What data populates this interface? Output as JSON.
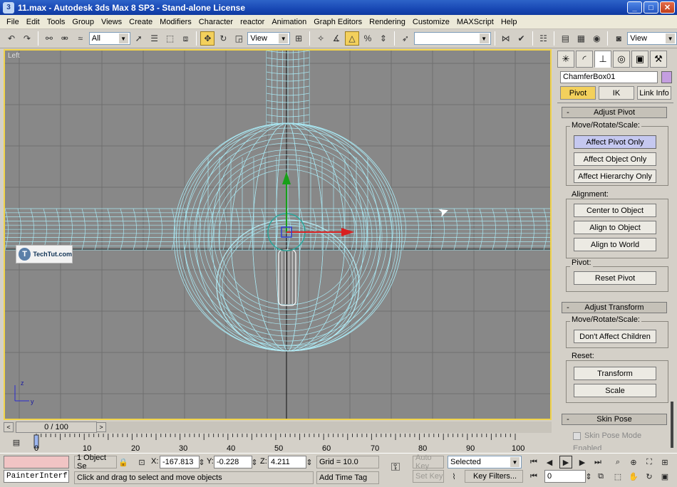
{
  "window": {
    "title": "11.max - Autodesk 3ds Max 8 SP3  - Stand-alone License",
    "app_icon": "3",
    "buttons": [
      "_",
      "□",
      "✕"
    ]
  },
  "menu": [
    "File",
    "Edit",
    "Tools",
    "Group",
    "Views",
    "Create",
    "Modifiers",
    "Character",
    "reactor",
    "Animation",
    "Graph Editors",
    "Rendering",
    "Customize",
    "MAXScript",
    "Help"
  ],
  "toolbar": {
    "selection_filter": "All",
    "ref_coord": "View",
    "named_selection": "",
    "right_view": "View"
  },
  "viewport": {
    "label": "Left",
    "watermark": "TechTut.com",
    "watermark_logo": "T",
    "axis_z": "z",
    "axis_y": "y"
  },
  "command_panel": {
    "object_name": "ChamferBox01",
    "object_color": "#c49ee0",
    "tabs": [
      "Pivot",
      "IK",
      "Link Info"
    ],
    "adjust_pivot": {
      "title": "Adjust Pivot",
      "minus": "-",
      "move_group": "Move/Rotate/Scale:",
      "buttons": [
        "Affect Pivot Only",
        "Affect Object Only",
        "Affect Hierarchy Only"
      ],
      "alignment_group": "Alignment:",
      "alignment_buttons": [
        "Center to Object",
        "Align to Object",
        "Align to World"
      ],
      "pivot_group": "Pivot:",
      "pivot_button": "Reset Pivot"
    },
    "adjust_transform": {
      "title": "Adjust Transform",
      "minus": "-",
      "move_group": "Move/Rotate/Scale:",
      "button": "Don't Affect Children",
      "reset_group": "Reset:",
      "reset_buttons": [
        "Transform",
        "Scale"
      ]
    },
    "skin_pose": {
      "title": "Skin Pose",
      "minus": "-",
      "checkbox": "Skin Pose Mode",
      "partial": "Enabled"
    }
  },
  "timeline": {
    "frame_display": "0 / 100",
    "ticks": [
      "0",
      "10",
      "20",
      "30",
      "40",
      "50",
      "60",
      "70",
      "80",
      "90",
      "100"
    ]
  },
  "status": {
    "script_listener": "PainterInterf",
    "selection_info": "1 Object Se",
    "x_label": "X:",
    "x_value": "-167.813",
    "y_label": "Y:",
    "y_value": "-0.228",
    "z_label": "Z:",
    "z_value": "4.211",
    "grid": "Grid = 10.0",
    "prompt": "Click and drag to select and move objects",
    "add_time_tag": "Add Time Tag",
    "auto_key": "Auto Key",
    "set_key": "Set Key",
    "key_mode": "Selected",
    "key_filters": "Key Filters...",
    "frame": "0"
  }
}
